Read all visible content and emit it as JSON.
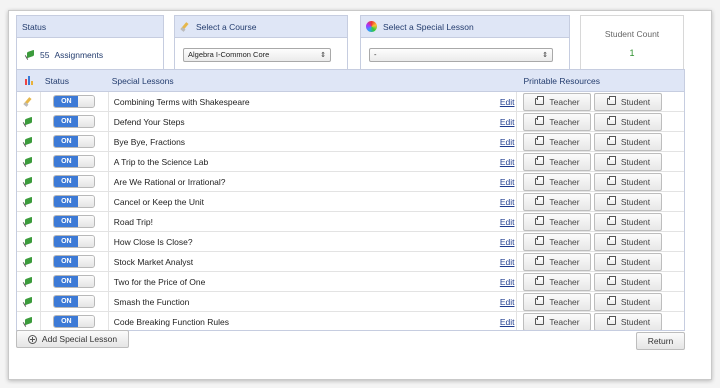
{
  "status_panel": {
    "title": "Status",
    "assignments_count": "55",
    "assignments_label": "Assignments"
  },
  "course_panel": {
    "title": "Select a Course",
    "selected": "Algebra I-Common Core"
  },
  "special_panel": {
    "title": "Select a Special Lesson",
    "selected": "-"
  },
  "count_panel": {
    "label": "Student Count",
    "value": "1"
  },
  "table": {
    "headers": {
      "status": "Status",
      "lessons": "Special Lessons",
      "printable": "Printable Resources"
    },
    "toggle_label": "ON",
    "edit_label": "Edit",
    "teacher_label": "Teacher",
    "student_label": "Student",
    "rows": [
      {
        "icon": "pencil-icon",
        "lesson": "Combining Terms with Shakespeare"
      },
      {
        "icon": "flag-icon",
        "lesson": "Defend Your Steps"
      },
      {
        "icon": "flag-icon",
        "lesson": "Bye Bye, Fractions"
      },
      {
        "icon": "flag-icon",
        "lesson": "A Trip to the Science Lab"
      },
      {
        "icon": "flag-icon",
        "lesson": "Are We Rational or Irrational?"
      },
      {
        "icon": "flag-icon",
        "lesson": "Cancel or Keep the Unit"
      },
      {
        "icon": "flag-icon",
        "lesson": "Road Trip!"
      },
      {
        "icon": "flag-icon",
        "lesson": "How Close Is Close?"
      },
      {
        "icon": "flag-icon",
        "lesson": "Stock Market Analyst"
      },
      {
        "icon": "flag-icon",
        "lesson": "Two for the Price of One"
      },
      {
        "icon": "flag-icon",
        "lesson": "Smash the Function"
      },
      {
        "icon": "flag-icon",
        "lesson": "Code Breaking Function Rules"
      }
    ]
  },
  "buttons": {
    "add": "Add Special Lesson",
    "return": "Return"
  }
}
